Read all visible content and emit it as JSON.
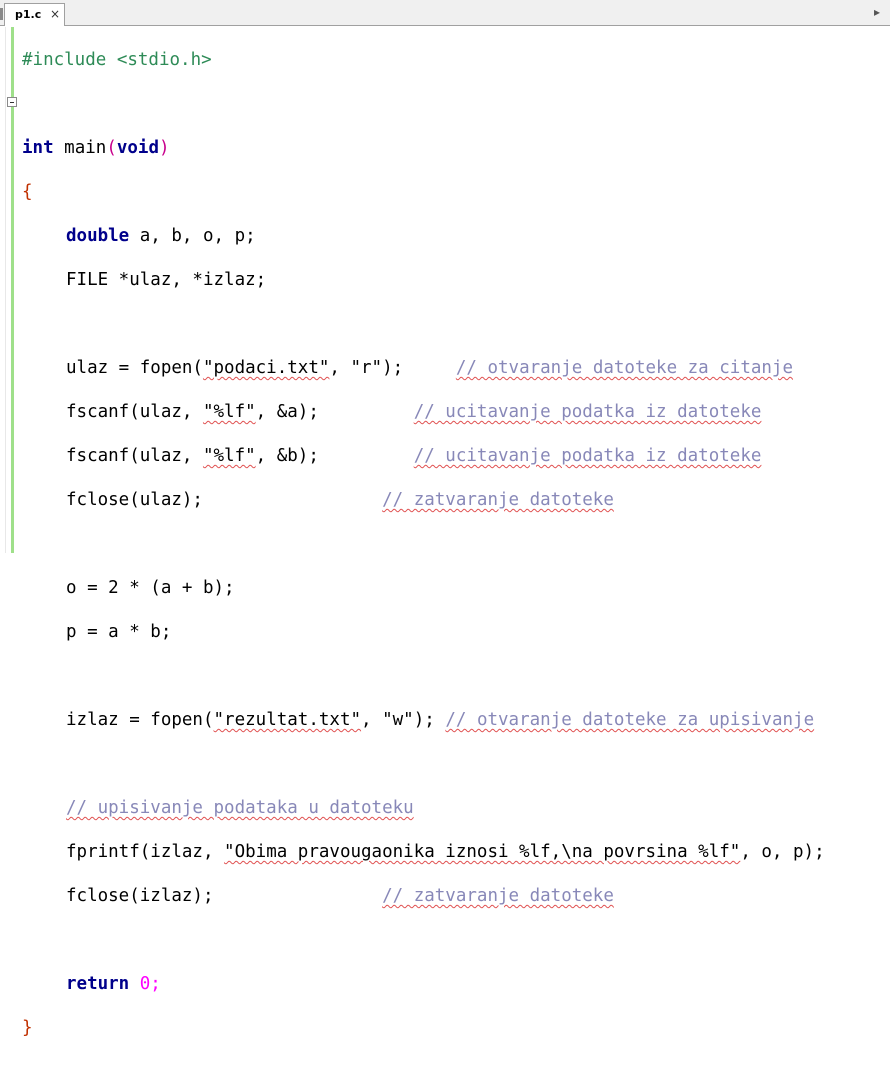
{
  "tab": {
    "title": "p1.c",
    "close": "×"
  },
  "tabbar": {
    "scroll_right": "▸"
  },
  "code": {
    "l1": "#include <stdio.h>",
    "l3_kw": "int",
    "l3_rest": "main",
    "l3_kw2": "void",
    "l4": "{",
    "l5_kw": "double",
    "l5_rest": "a, b, o, p;",
    "l6": "FILE *ulaz, *izlaz;",
    "l8_a": "ulaz = fopen(",
    "l8_s1": "\"podaci.txt\"",
    "l8_mid": ", ",
    "l8_s2": "\"r\"",
    "l8_end": ");",
    "l8_cm": "// otvaranje datoteke za citanje",
    "l9_a": "fscanf(ulaz, ",
    "l9_s": "\"%lf\"",
    "l9_end": ", &a);",
    "l9_cm": "// ucitavanje podatka iz datoteke",
    "l10_a": "fscanf(ulaz, ",
    "l10_s": "\"%lf\"",
    "l10_end": ", &b);",
    "l10_cm": "// ucitavanje podatka iz datoteke",
    "l11_a": "fclose(ulaz);",
    "l11_cm": "// zatvaranje datoteke",
    "l13": "o = 2 * (a + b);",
    "l14": "p = a * b;",
    "l16_a": "izlaz = fopen(",
    "l16_s1": "\"rezultat.txt\"",
    "l16_mid": ", ",
    "l16_s2": "\"w\"",
    "l16_end": ");",
    "l16_cm": "// otvaranje datoteke za upisivanje",
    "l18_cm": "// upisivanje podataka u datoteku",
    "l19_a": "fprintf(izlaz, ",
    "l19_s": "\"Obima pravougaonika iznosi %lf,\\na povrsina %lf\"",
    "l19_end": ", o, p);",
    "l20_a": "fclose(izlaz);",
    "l20_cm": "// zatvaranje datoteke",
    "l22_kw": "return",
    "l22_rest": "0;",
    "l23": "}"
  },
  "colors": {
    "preprocessor": "#2e8b57",
    "keyword": "#00008b",
    "operator": "#c8008c",
    "number": "#ff00ff",
    "comment": "#8888b8",
    "fold_bar": "#9fe08a"
  }
}
